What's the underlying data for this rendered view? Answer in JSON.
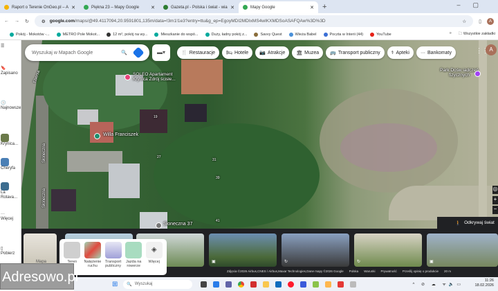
{
  "browser": {
    "tabs": [
      {
        "title": "Raport o Terenie OnGeo.pl – A",
        "color": "#f4b400"
      },
      {
        "title": "Piękna 23 – Mapy Google",
        "color": "#34a853"
      },
      {
        "title": "Gazeta.pl - Polska i świat - wia",
        "color": "#2e7d32"
      },
      {
        "title": "Mapy Google",
        "color": "#34a853",
        "active": true
      }
    ],
    "url_host": "google.com",
    "url_rest": "/maps/@49.4117094,20.9591801,135m/data=!3m1!1e3?entry=ttu&g_ep=EgoyMDI2MDIxMS4wIKXMDSoASAFQAw%3D%3D",
    "profile_initial": "A",
    "bookmarks": [
      {
        "label": "Pokój - Mokotów -...",
        "color": "#00a99d"
      },
      {
        "label": "METRO Pole Mokot...",
        "color": "#00a99d"
      },
      {
        "label": "12 m², pokój na wy...",
        "color": "#333"
      },
      {
        "label": "Mieszkanie do wspó...",
        "color": "#00a99d"
      },
      {
        "label": "Duży, ładny pokój z...",
        "color": "#00a99d"
      },
      {
        "label": "Savvy Quest",
        "color": "#8a6d3b"
      },
      {
        "label": "Wieża Babel",
        "color": "#4a90d9"
      },
      {
        "label": "Poczta w Interii (44)",
        "color": "#3b6fd6"
      },
      {
        "label": "YouTube",
        "color": "#e62117"
      }
    ],
    "bookmarks_more": "»",
    "all_bookmarks": "Wszystkie zakładki"
  },
  "sidebar": {
    "items": [
      "Zapisano",
      "Najnowsze",
      "Krynica...",
      "Cheryfa",
      "La Rotava...",
      "Więcej",
      "Pobierz"
    ]
  },
  "map": {
    "search_placeholder": "Wyszukaj w Mapach Google",
    "chips": [
      {
        "icon": "fork-knife-icon",
        "glyph": "🍴",
        "label": "Restauracje"
      },
      {
        "icon": "bed-icon",
        "glyph": "🛏",
        "label": "Hotele"
      },
      {
        "icon": "camera-icon",
        "glyph": "📷",
        "label": "Atrakcje"
      },
      {
        "icon": "museum-icon",
        "glyph": "🏛",
        "label": "Muzea"
      },
      {
        "icon": "bus-icon",
        "glyph": "🚌",
        "label": "Transport publiczny"
      },
      {
        "icon": "pharmacy-icon",
        "glyph": "⚕",
        "label": "Apteki"
      },
      {
        "icon": "atm-icon",
        "glyph": "···",
        "label": "Bankomaty"
      }
    ],
    "places": {
      "apartment": "SOLEO Apartament Krynica Zdrój ścisłe...",
      "villa": "Willa Franciszek",
      "park": "Park Dośw iadczeń fizycznych",
      "address": "Słoneczna 37"
    },
    "streets": [
      "Ebersa",
      "Słoneczna",
      "Słoneczna",
      "Słoneczna"
    ],
    "house_numbers": [
      "19",
      "27",
      "31",
      "39",
      "41"
    ],
    "explore_label": "Odkrywaj świat"
  },
  "layers": {
    "items": [
      "Teren",
      "Natężenie ruchu",
      "Transport publiczny",
      "Jazda na rowerze",
      "Więcej"
    ],
    "map_label": "Mapa"
  },
  "attribution": [
    "Zdjęcia ©2026 Airbus,CNES / Airbus,Maxar Technologies,Dane mapy ©2026 Google",
    "Polska",
    "Warunki",
    "Prywatność",
    "Prześlij opinię o produkcie",
    "20 m"
  ],
  "watermark": "Adresowo.pl",
  "taskbar": {
    "search_placeholder": "Wyszukaj",
    "time": "11:26",
    "date": "18.02.2026"
  }
}
